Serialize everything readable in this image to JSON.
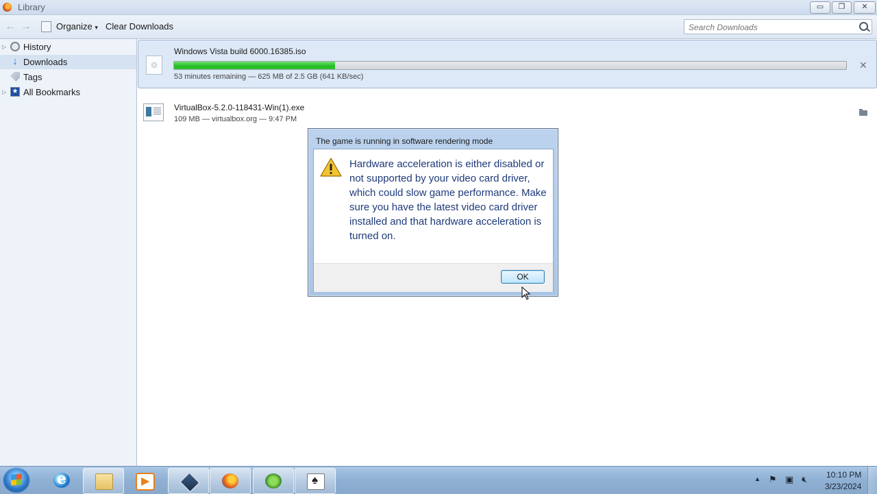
{
  "window": {
    "title": "Library",
    "controls": {
      "minimize": "▭",
      "restore": "❐",
      "close": "✕"
    }
  },
  "toolbar": {
    "organize_label": "Organize",
    "organize_caret": "▾",
    "clear_label": "Clear Downloads",
    "search_placeholder": "Search Downloads"
  },
  "sidebar": {
    "items": [
      {
        "label": "History",
        "icon": "history-icon"
      },
      {
        "label": "Downloads",
        "icon": "downloads-icon",
        "selected": true
      },
      {
        "label": "Tags",
        "icon": "tags-icon"
      },
      {
        "label": "All Bookmarks",
        "icon": "bookmarks-icon"
      }
    ]
  },
  "downloads": [
    {
      "name": "Windows Vista build 6000.16385.iso",
      "status": "53 minutes remaining — 625 MB of 2.5 GB (641 KB/sec)",
      "progress": 0.24,
      "action_icon": "cancel-icon"
    },
    {
      "name": "VirtualBox-5.2.0-118431-Win(1).exe",
      "status": "109 MB — virtualbox.org — 9:47 PM",
      "action_icon": "folder-icon"
    }
  ],
  "dialog": {
    "title": "The game is running in software rendering mode",
    "message": "Hardware acceleration is either disabled or not supported by your video card driver, which could slow game performance. Make sure you have the latest video card driver installed and that hardware acceleration is turned on.",
    "ok_label": "OK",
    "icon": "warning-icon"
  },
  "taskbar": {
    "apps": [
      "internet-explorer",
      "windows-explorer",
      "media-player",
      "virtualbox",
      "firefox",
      "windows",
      "solitaire"
    ],
    "active_app": "firefox",
    "clock_time": "10:10 PM",
    "clock_date": "3/23/2024"
  },
  "colors": {
    "progress_fill": "#23bb23",
    "dialog_text": "#1d3a7a",
    "selection": "#d5e2f1"
  }
}
